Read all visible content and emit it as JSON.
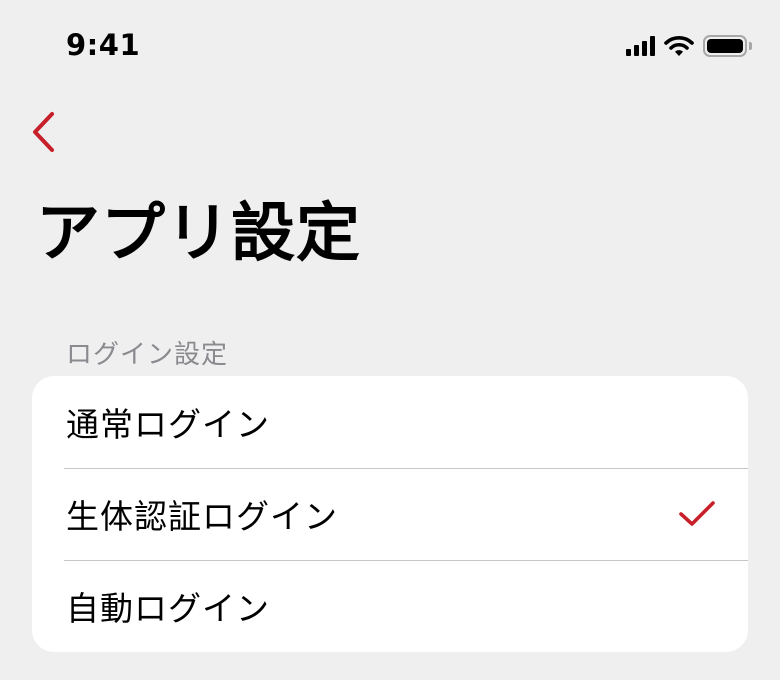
{
  "status_bar": {
    "time": "9:41",
    "icons": [
      "cellular-signal-icon",
      "wifi-icon",
      "battery-icon"
    ]
  },
  "nav": {
    "back_icon": "chevron-left-icon"
  },
  "page": {
    "title": "アプリ設定"
  },
  "login_section": {
    "header": "ログイン設定",
    "options": [
      {
        "label": "通常ログイン",
        "selected": false
      },
      {
        "label": "生体認証ログイン",
        "selected": true
      },
      {
        "label": "自動ログイン",
        "selected": false
      }
    ]
  },
  "colors": {
    "accent": "#c8202a",
    "background": "#efefef",
    "card": "#ffffff",
    "separator": "#c6c6c8",
    "secondary_text": "#8a8a8f"
  }
}
